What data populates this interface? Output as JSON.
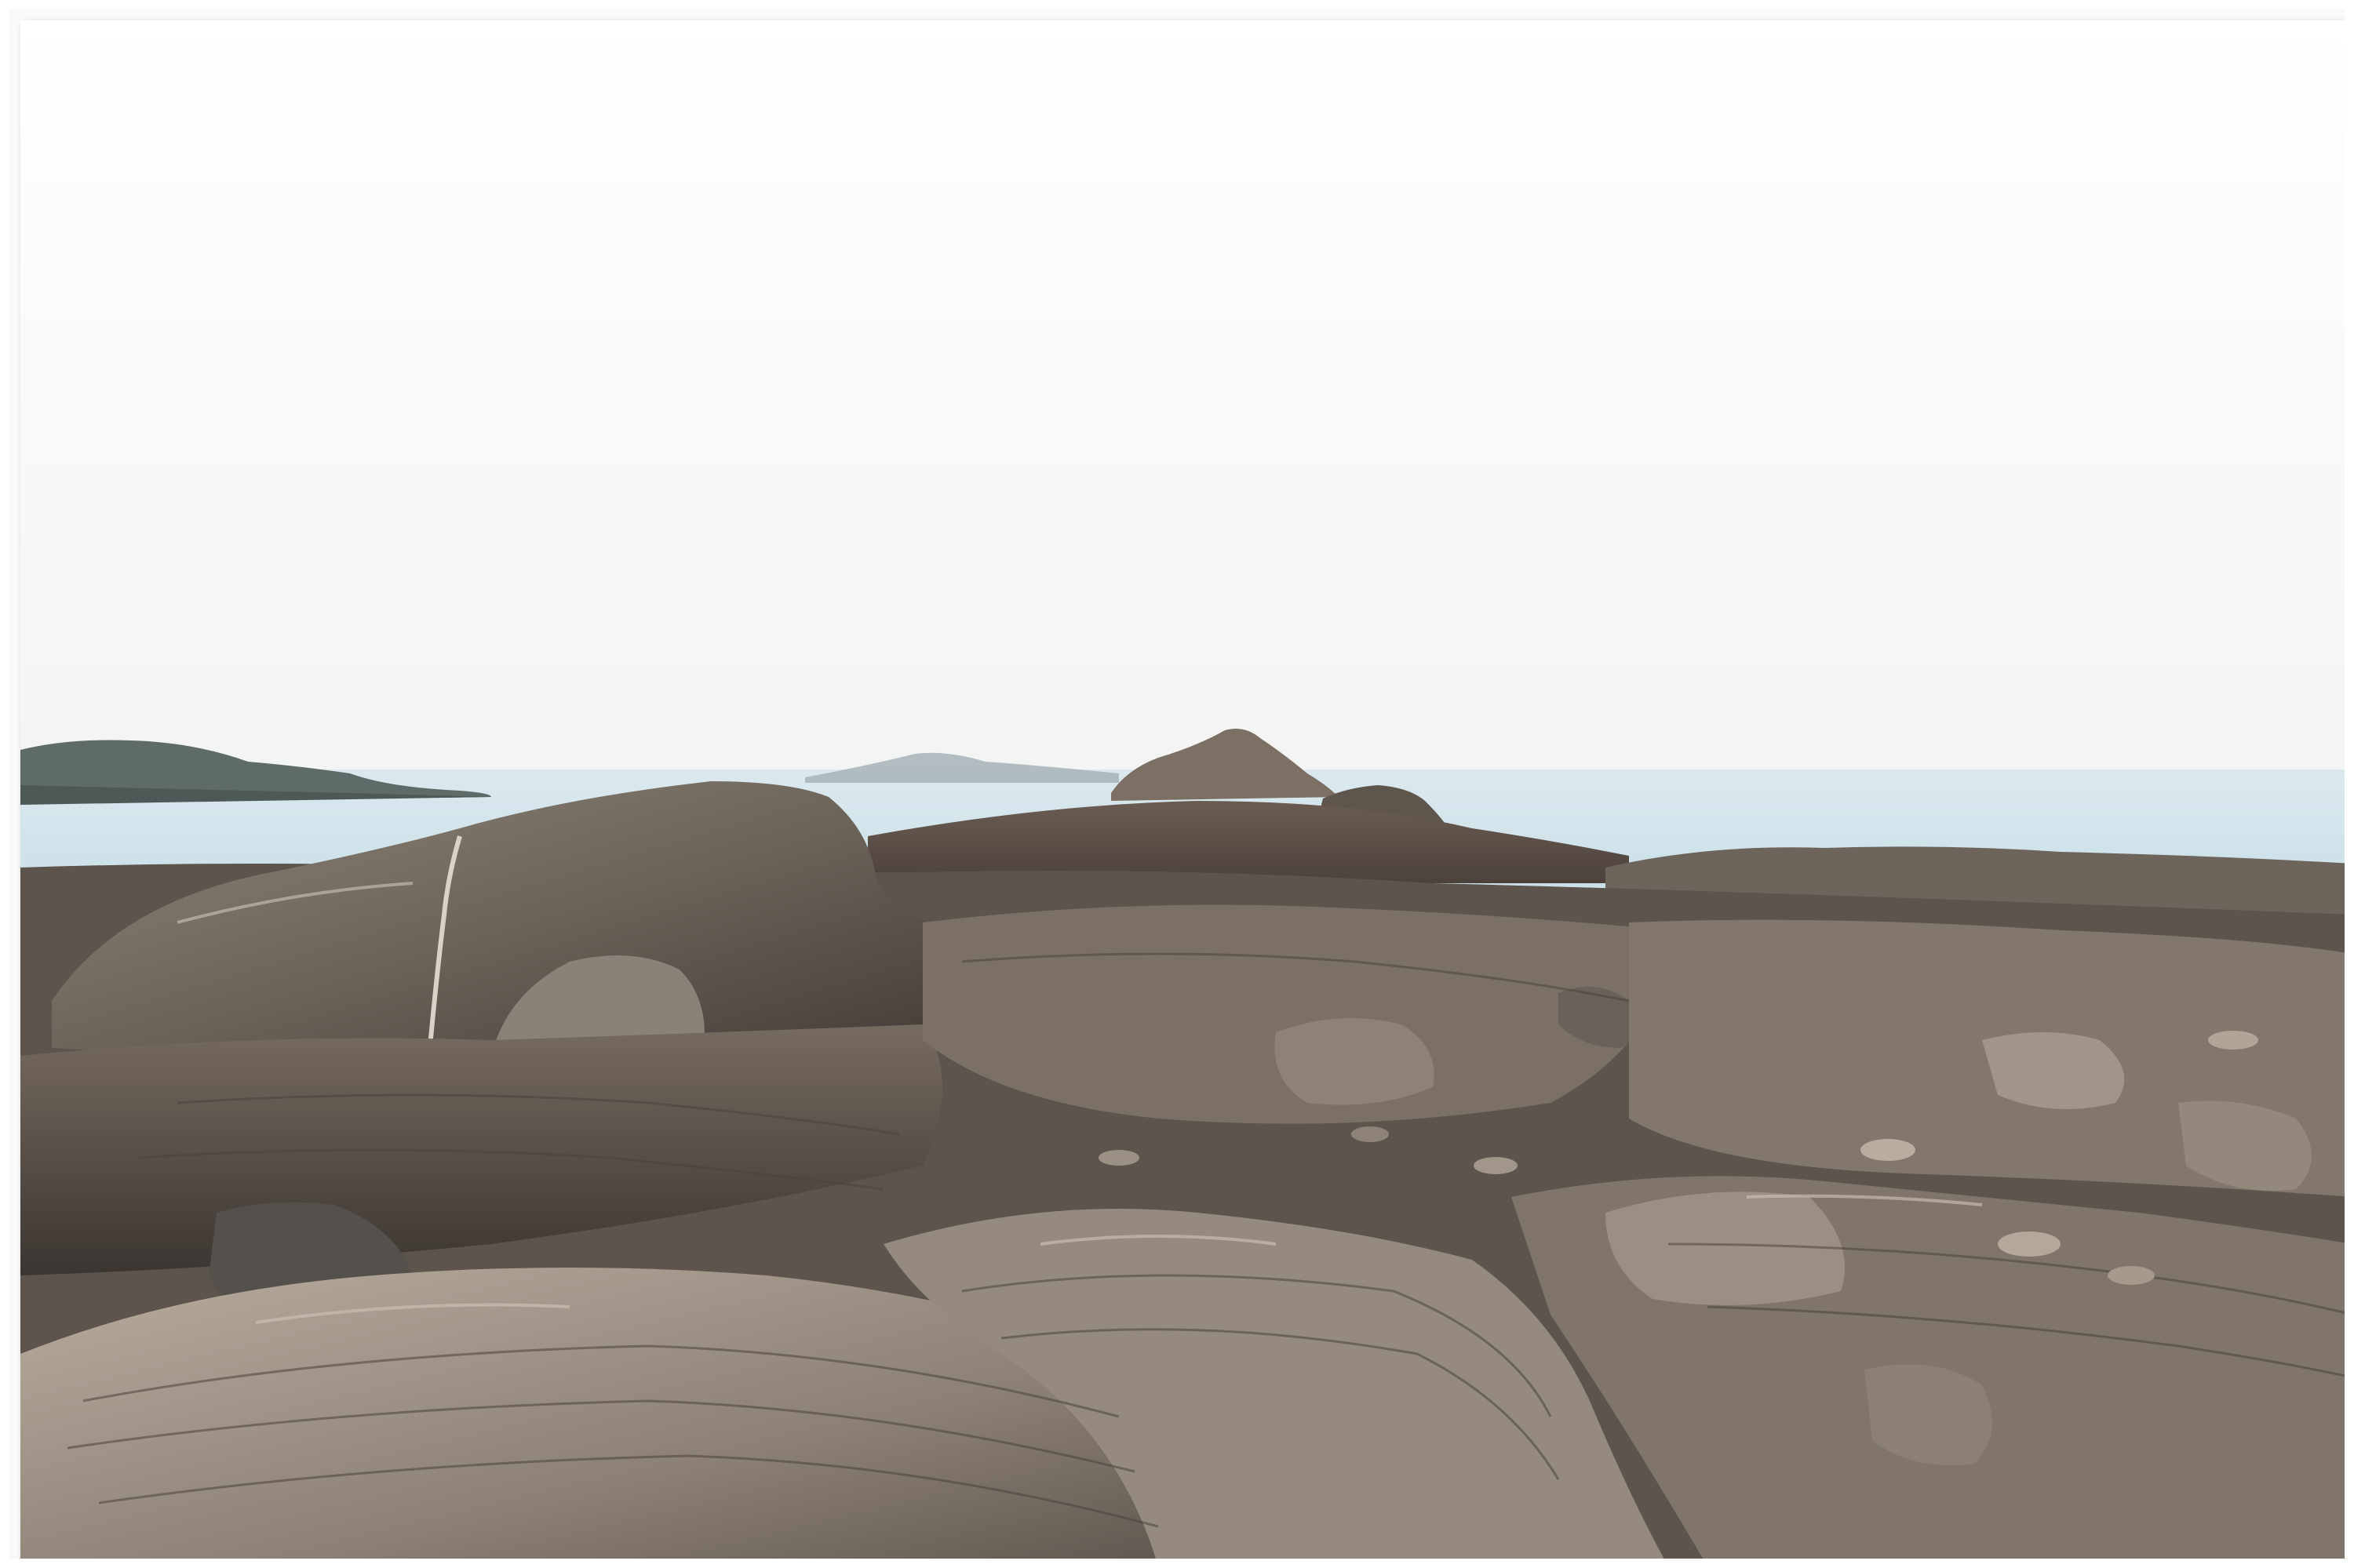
{
  "scene": {
    "colors": {
      "sky": "#fbfbfb",
      "sea": "#cfe3ea",
      "sea_far": "#dbe9ee",
      "island": "#5e6a66",
      "island_far": "#9aa7ab",
      "rock_dark": "#3f3a36",
      "rock_mid": "#6e665e",
      "rock_light": "#a59a8d",
      "rock_highlight": "#c9bfb2",
      "mudflat": "#5a4d45",
      "frame_shadow": "#333333"
    }
  }
}
